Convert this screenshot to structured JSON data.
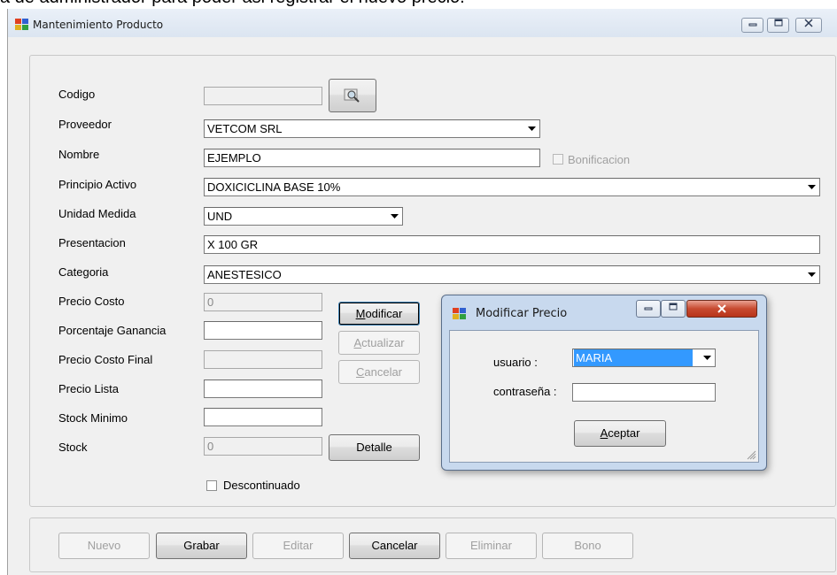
{
  "background_caption": "a de administrador para poder asi registrar el nuevo precio.",
  "window": {
    "title": "Mantenimiento Producto",
    "buttons": {
      "minimize": "▭",
      "maximize": "▢",
      "close": "✕"
    }
  },
  "form": {
    "codigo": {
      "label": "Codigo",
      "value": ""
    },
    "proveedor": {
      "label": "Proveedor",
      "value": "VETCOM  SRL"
    },
    "nombre": {
      "label": "Nombre",
      "value": "EJEMPLO"
    },
    "bonificacion": {
      "label": "Bonificacion",
      "checked": false
    },
    "principio_activo": {
      "label": "Principio Activo",
      "value": "DOXICICLINA BASE 10%"
    },
    "unidad_medida": {
      "label": "Unidad Medida",
      "value": "UND"
    },
    "presentacion": {
      "label": "Presentacion",
      "value": "X 100 GR"
    },
    "categoria": {
      "label": "Categoria",
      "value": "ANESTESICO"
    },
    "precio_costo": {
      "label": "Precio Costo",
      "value": "0"
    },
    "porcentaje_ganancia": {
      "label": "Porcentaje Ganancia",
      "value": ""
    },
    "precio_costo_final": {
      "label": "Precio Costo Final",
      "value": ""
    },
    "precio_lista": {
      "label": "Precio Lista",
      "value": ""
    },
    "stock_minimo": {
      "label": "Stock Minimo",
      "value": ""
    },
    "stock": {
      "label": "Stock",
      "value": "0"
    },
    "descontinuado": {
      "label": "Descontinuado",
      "checked": false
    }
  },
  "price_buttons": {
    "modificar": {
      "underline": "M",
      "rest": "odificar"
    },
    "actualizar": {
      "underline": "A",
      "rest": "ctualizar"
    },
    "cancelar": {
      "underline": "C",
      "rest": "ancelar"
    }
  },
  "detalle_label": "Detalle",
  "bottom_buttons": {
    "nuevo": "Nuevo",
    "grabar": "Grabar",
    "editar": "Editar",
    "cancelar": "Cancelar",
    "eliminar": "Eliminar",
    "bono": "Bono"
  },
  "dialog": {
    "title": "Modificar Precio",
    "usuario_label": "usuario :",
    "usuario_value": "MARIA",
    "contrasena_label": "contraseña :",
    "contrasena_value": "",
    "aceptar": {
      "underline": "A",
      "rest": "ceptar"
    }
  },
  "colors": {
    "selection": "#3399ff",
    "window_bg": "#f0f0f0",
    "dialog_frame": "#c8d9ee"
  }
}
